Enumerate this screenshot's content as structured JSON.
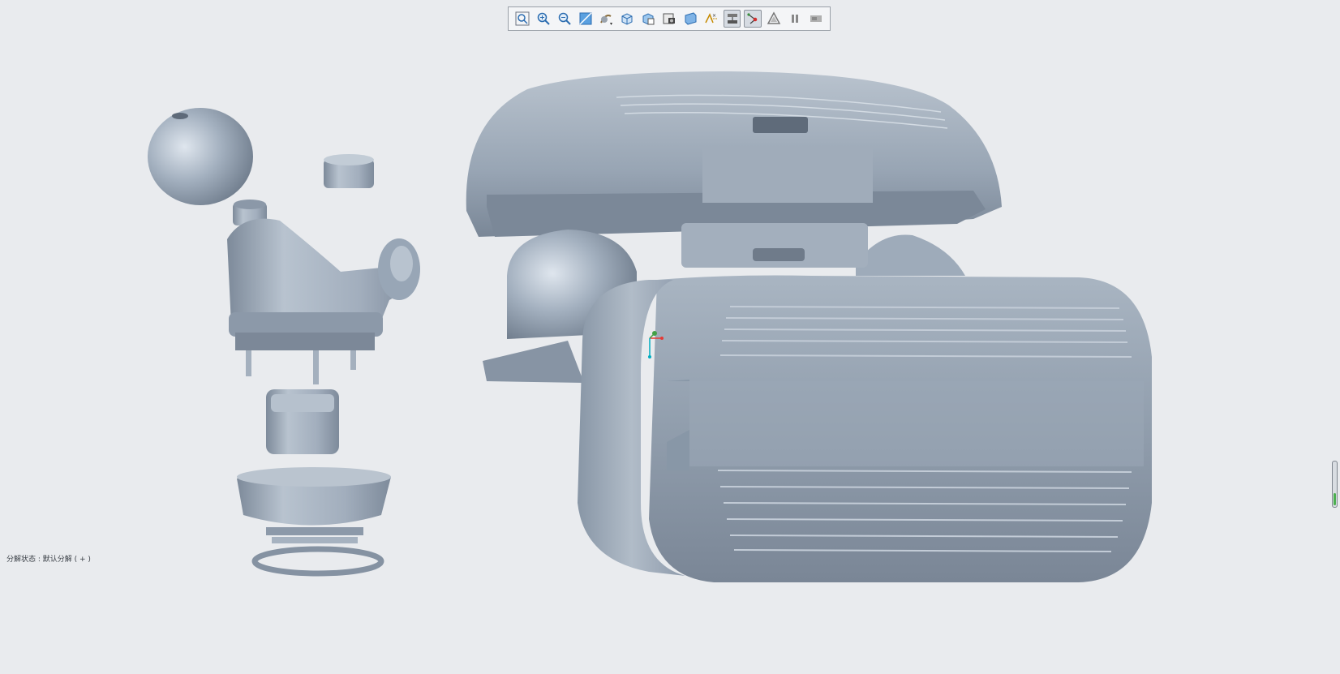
{
  "toolbar": {
    "buttons": [
      {
        "icon": "zoom-fit-icon"
      },
      {
        "icon": "zoom-in-icon"
      },
      {
        "icon": "zoom-out-icon"
      },
      {
        "icon": "repaint-icon"
      },
      {
        "icon": "reorient-icon"
      },
      {
        "icon": "display-style-icon"
      },
      {
        "icon": "saved-views-icon"
      },
      {
        "icon": "view-manager-icon"
      },
      {
        "icon": "perspective-icon"
      },
      {
        "icon": "datum-display-icon"
      },
      {
        "icon": "explode-view-icon",
        "active": true
      },
      {
        "icon": "annotation-display-icon",
        "active": true
      },
      {
        "icon": "spin-center-icon"
      },
      {
        "icon": "pause-icon"
      },
      {
        "icon": "flag-icon"
      }
    ]
  },
  "status": {
    "explode_state": "分解状态 : 默认分解 ( + )"
  },
  "colors": {
    "background": "#e9ebee",
    "model": "#9aa8b8",
    "model_shadow": "#6d7a8b",
    "model_highlight": "#c7d0da"
  },
  "scroll_indicator": {
    "level": 0.28
  }
}
